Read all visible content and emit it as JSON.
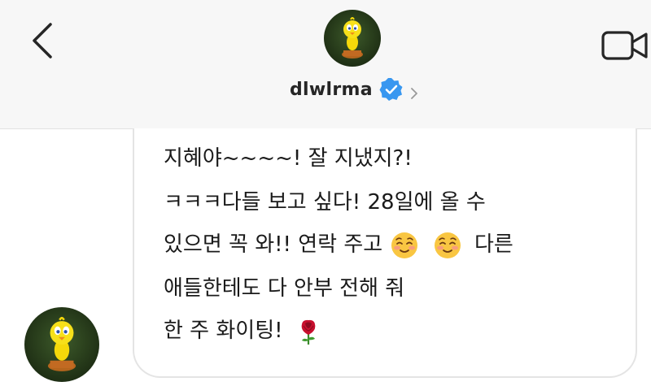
{
  "header": {
    "username": "dlwlrma",
    "verified": true
  },
  "icons": {
    "back": "chevron-left-icon",
    "video": "video-call-icon",
    "verified": "verified-badge-icon",
    "profile_chevron": "chevron-right-icon"
  },
  "message": {
    "line1": "지혜야~~~~! 잘 지냈지?!",
    "line2": "ㅋㅋㅋ다들 보고 싶다! 28일에 올 수",
    "line3a": "있으면 꼭 와!! 연락 주고",
    "line3b": "다른",
    "line4": "애들한테도 다 안부 전해 줘",
    "line5": "한 주 화이팅!",
    "emojis": [
      "relieved-face",
      "relieved-face",
      "rose"
    ]
  },
  "colors": {
    "header_bg": "#f7f7f7",
    "bubble_border": "#e4e4e4",
    "verified_blue": "#3897f0",
    "text": "#1a1a1a"
  }
}
